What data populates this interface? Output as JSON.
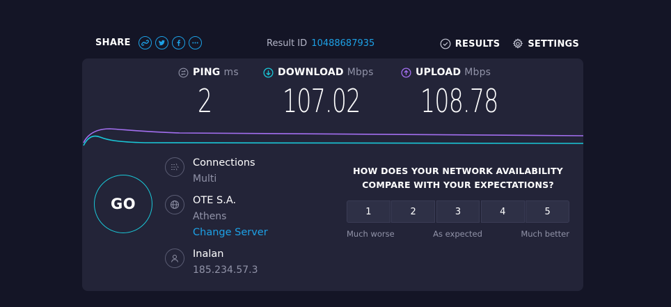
{
  "header": {
    "share_label": "SHARE",
    "share_buttons": [
      "link-icon",
      "twitter-icon",
      "facebook-icon",
      "more-icon"
    ],
    "result_label": "Result ID",
    "result_id": "10488687935",
    "results_label": "RESULTS",
    "settings_label": "SETTINGS"
  },
  "metrics": {
    "ping": {
      "label": "PING",
      "unit": "ms",
      "value": "2"
    },
    "download": {
      "label": "DOWNLOAD",
      "unit": "Mbps",
      "value": "107.02"
    },
    "upload": {
      "label": "UPLOAD",
      "unit": "Mbps",
      "value": "108.78"
    }
  },
  "go_label": "GO",
  "connection": {
    "connections_label": "Connections",
    "connections_value": "Multi",
    "server_name": "OTE S.A.",
    "server_location": "Athens",
    "change_server_label": "Change Server",
    "provider_name": "Inalan",
    "ip_address": "185.234.57.3"
  },
  "survey": {
    "question_line1": "HOW DOES YOUR NETWORK AVAILABILITY",
    "question_line2": "COMPARE WITH YOUR EXPECTATIONS?",
    "options": [
      "1",
      "2",
      "3",
      "4",
      "5"
    ],
    "low_label": "Much worse",
    "mid_label": "As expected",
    "high_label": "Much better"
  },
  "colors": {
    "accent": "#1da1e6",
    "download": "#1ac8d8",
    "upload": "#a36ff0",
    "panel": "#232438",
    "background": "#141526"
  }
}
